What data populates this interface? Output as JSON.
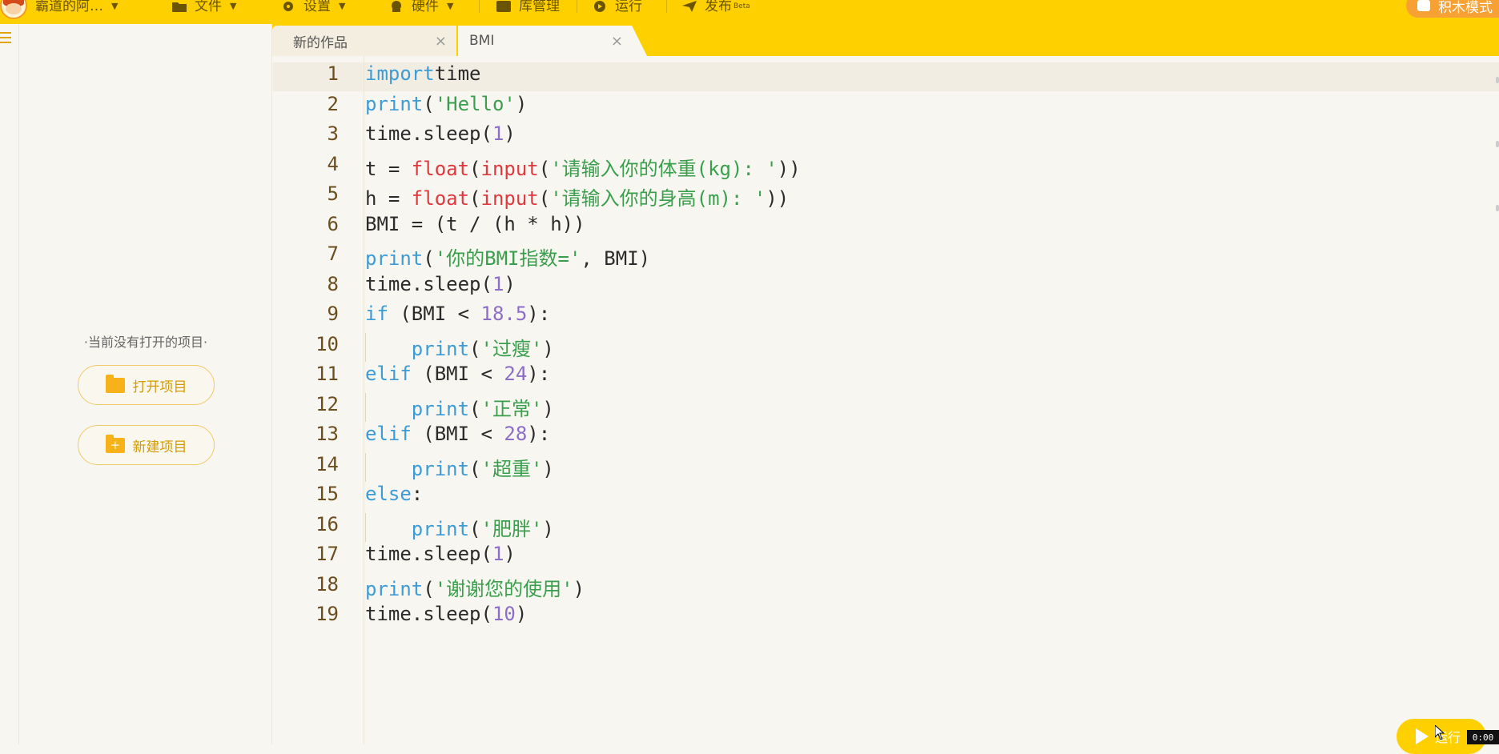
{
  "colors": {
    "accent": "#ffd000",
    "orange": "#f7a033",
    "keyword": "#3d9bd6",
    "builtin": "#e0383e",
    "string": "#3a9f4d",
    "number": "#8c6dc7"
  },
  "topbar": {
    "user_label": "霸道的阿…",
    "menus": [
      {
        "label": "文件",
        "icon": "folder-icon"
      },
      {
        "label": "设置",
        "icon": "gear-icon"
      },
      {
        "label": "硬件",
        "icon": "hardware-icon"
      },
      {
        "label": "库管理",
        "icon": "library-icon"
      },
      {
        "label": "运行",
        "icon": "play-icon"
      },
      {
        "label": "发布",
        "icon": "send-icon",
        "badge": "Beta"
      }
    ],
    "mode_button": "积木模式"
  },
  "tabs": [
    {
      "label": "新的作品",
      "close": "×"
    },
    {
      "label": "BMI",
      "close": "×"
    }
  ],
  "sidebar": {
    "empty_message": "·当前没有打开的项目·",
    "open_project": "打开项目",
    "new_project": "新建项目"
  },
  "editor": {
    "line_numbers": [
      "1",
      "2",
      "3",
      "4",
      "5",
      "6",
      "7",
      "8",
      "9",
      "10",
      "11",
      "12",
      "13",
      "14",
      "15",
      "16",
      "17",
      "18",
      "19"
    ]
  },
  "run_button": "运行",
  "timer": "0:00"
}
